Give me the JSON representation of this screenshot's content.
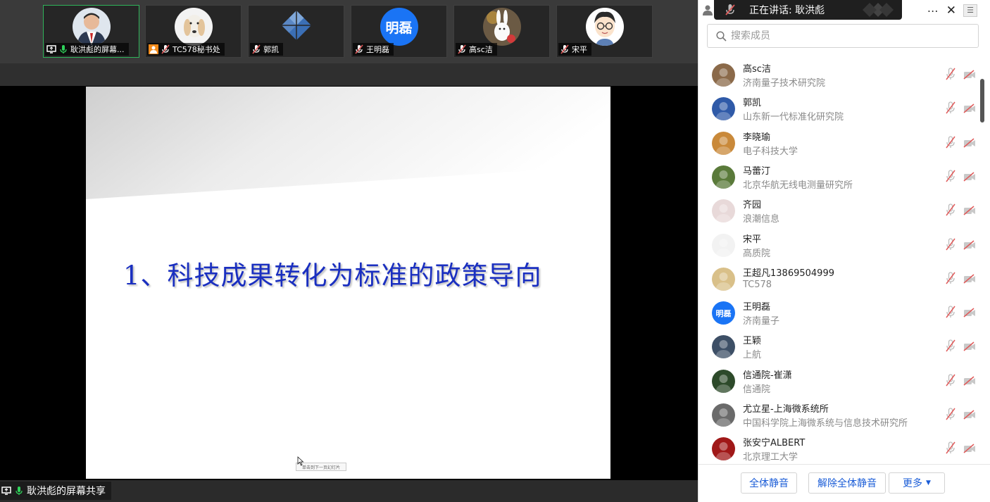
{
  "participants_strip": [
    {
      "name": "耿洪彪的屏幕...",
      "avatar": "photo-man-suit",
      "active": true
    },
    {
      "name": "TC578秘书处",
      "avatar": "photo-dog"
    },
    {
      "name": "郭凯",
      "avatar": "logo-diamond"
    },
    {
      "name": "王明磊",
      "avatar_text": "明磊",
      "avatar_color": "#1a74f5"
    },
    {
      "name": "高sc洁",
      "avatar": "photo-bunny"
    },
    {
      "name": "宋平",
      "avatar": "cartoon-boy"
    }
  ],
  "slide": {
    "title": "1、科技成果转化为标准的政策导向",
    "hint": "单击到下一页幻灯片"
  },
  "share_status": "耿洪彪的屏幕共享",
  "speaker_bar": {
    "label": "正在讲话: 耿洪彪"
  },
  "search": {
    "placeholder": "搜索成员"
  },
  "members": [
    {
      "name": "高sc洁",
      "org": "济南量子技术研究院",
      "avatar_color": "#8b6a4a"
    },
    {
      "name": "郭凯",
      "org": "山东新一代标准化研究院",
      "avatar_color": "#2f5aa8"
    },
    {
      "name": "李晓瑜",
      "org": "电子科技大学",
      "avatar_color": "#c9893a"
    },
    {
      "name": "马蕾汀",
      "org": "北京华航无线电测量研究所",
      "avatar_color": "#5a7a3a"
    },
    {
      "name": "齐园",
      "org": "浪潮信息",
      "avatar_color": "#e8d9d9"
    },
    {
      "name": "宋平",
      "org": "高质院",
      "avatar_color": "#f2f2f2"
    },
    {
      "name": "王超凡13869504999",
      "org": "TC578",
      "avatar_color": "#d9c089"
    },
    {
      "name": "王明磊",
      "org": "济南量子",
      "avatar_text": "明磊",
      "avatar_color": "#1a74f5"
    },
    {
      "name": "王颖",
      "org": "上航",
      "avatar_color": "#3d4f66"
    },
    {
      "name": "信通院-崔潇",
      "org": "信通院",
      "avatar_color": "#2d4a2a"
    },
    {
      "name": "尤立星-上海微系统所",
      "org": "中国科学院上海微系统与信息技术研究所",
      "avatar_color": "#6a6a6a"
    },
    {
      "name": "张安宁ALBERT",
      "org": "北京理工大学",
      "avatar_color": "#a01818"
    }
  ],
  "footer": {
    "mute_all": "全体静音",
    "unmute_all": "解除全体静音",
    "more": "更多"
  },
  "colors": {
    "active_border": "#2fb45a",
    "accent_blue": "#1a5cd7",
    "muted_red": "#e05a5a",
    "slide_title": "#1a2fc0"
  }
}
